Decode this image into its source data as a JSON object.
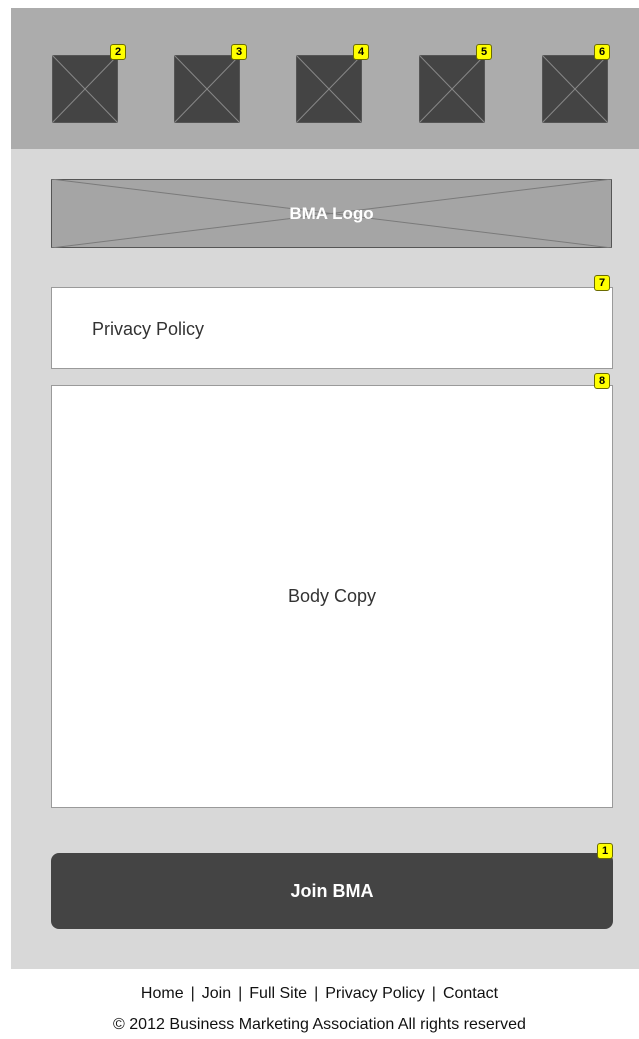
{
  "top_bar": {
    "icons": [
      {
        "marker": "2"
      },
      {
        "marker": "3"
      },
      {
        "marker": "4"
      },
      {
        "marker": "5"
      },
      {
        "marker": "6"
      }
    ]
  },
  "logo": {
    "label": "BMA Logo"
  },
  "privacy": {
    "label": "Privacy Policy",
    "marker": "7"
  },
  "body": {
    "label": "Body Copy",
    "marker": "8"
  },
  "join_button": {
    "label": "Join BMA",
    "marker": "1"
  },
  "footer": {
    "links": [
      "Home",
      "Join",
      "Full Site",
      "Privacy Policy",
      "Contact"
    ],
    "separator": "|",
    "copyright": "© 2012 Business Marketing Association All rights reserved"
  },
  "colors": {
    "top_bar_bg": "#acacac",
    "content_bg": "#d8d8d8",
    "button_bg": "#444444",
    "marker_bg": "#ffff00"
  }
}
